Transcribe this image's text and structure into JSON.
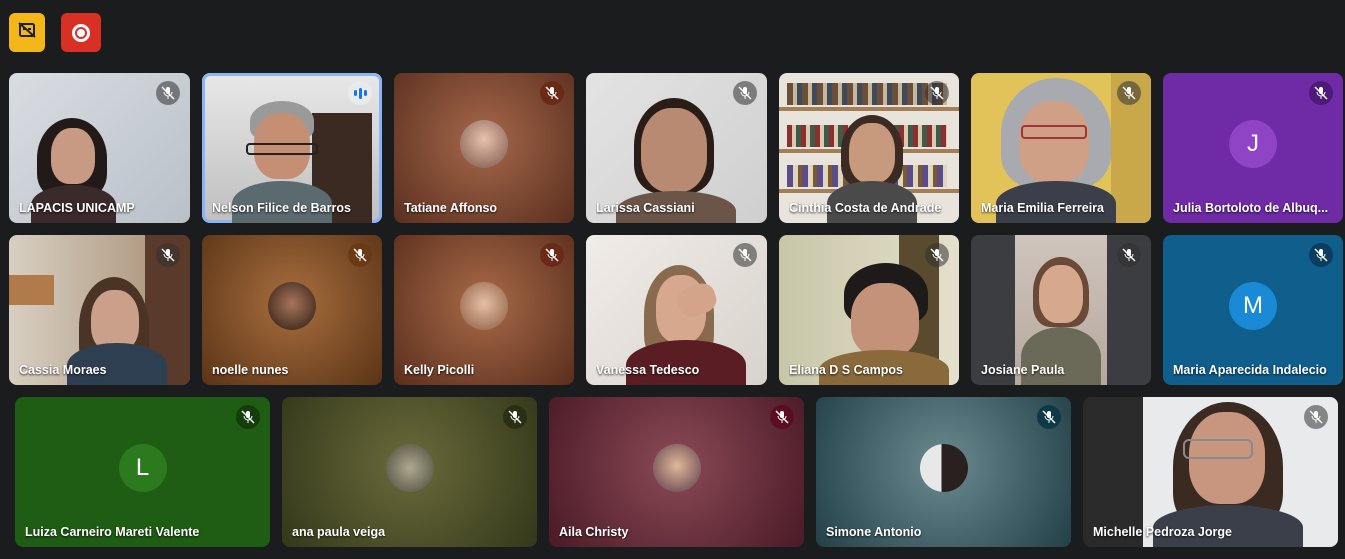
{
  "toolbar": {
    "captions_icon": "captions-off-icon",
    "record_icon": "recording-icon",
    "captions_color": "#f3b817",
    "record_color": "#d93025"
  },
  "participants": [
    {
      "name": "LAPACIS UNICAMP",
      "mic": "muted"
    },
    {
      "name": "Nelson Filice de Barros",
      "mic": "speaking"
    },
    {
      "name": "Tatiane Affonso",
      "mic": "muted"
    },
    {
      "name": "Larissa Cassiani",
      "mic": "muted"
    },
    {
      "name": "Cinthia Costa de Andrade",
      "mic": "muted"
    },
    {
      "name": "Maria Emilia Ferreira",
      "mic": "muted"
    },
    {
      "name": "Julia Bortoloto de Albuq...",
      "mic": "muted",
      "initial": "J"
    },
    {
      "name": "Cassia Moraes",
      "mic": "muted"
    },
    {
      "name": "noelle nunes",
      "mic": "muted"
    },
    {
      "name": "Kelly Picolli",
      "mic": "muted"
    },
    {
      "name": "Vanessa Tedesco",
      "mic": "muted"
    },
    {
      "name": "Eliana D S Campos",
      "mic": "muted"
    },
    {
      "name": "Josiane Paula",
      "mic": "muted"
    },
    {
      "name": "Maria Aparecida Indalecio",
      "mic": "muted",
      "initial": "M"
    },
    {
      "name": "Luiza Carneiro Mareti Valente",
      "mic": "muted",
      "initial": "L"
    },
    {
      "name": "ana paula veiga",
      "mic": "muted"
    },
    {
      "name": "Aila Christy",
      "mic": "muted"
    },
    {
      "name": "Simone Antonio",
      "mic": "muted"
    },
    {
      "name": "Michelle Pedroza Jorge",
      "mic": "muted"
    }
  ]
}
